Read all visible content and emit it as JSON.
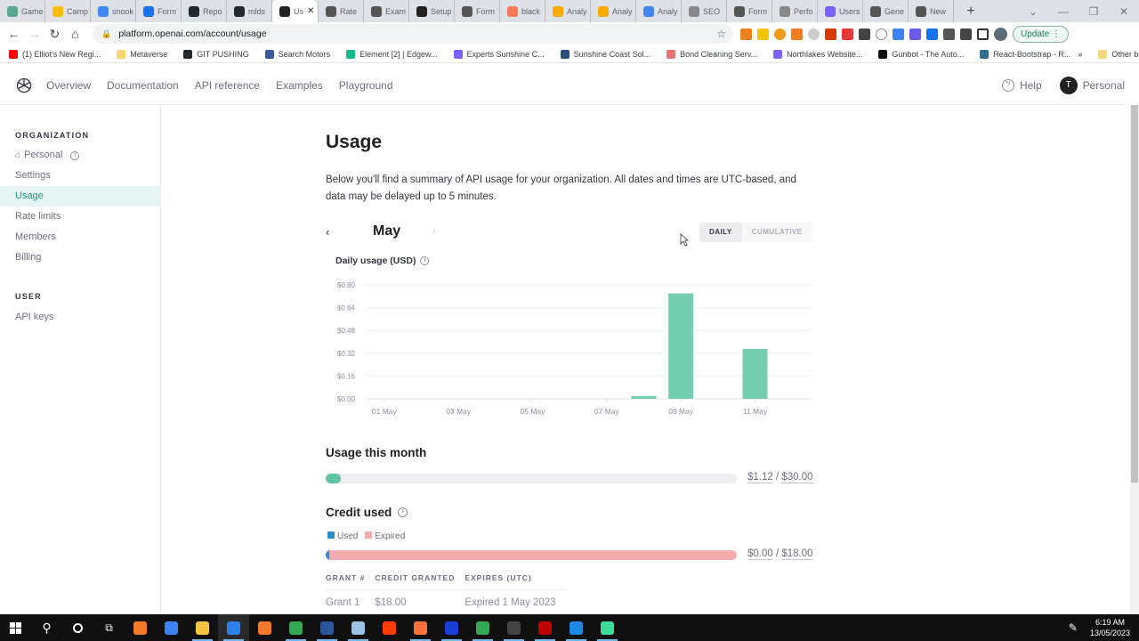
{
  "browser": {
    "tabs": [
      {
        "label": "Game",
        "color": "#5aa68f"
      },
      {
        "label": "Camp",
        "color": "#fbbc04"
      },
      {
        "label": "snook",
        "color": "#4285f4"
      },
      {
        "label": "Form",
        "color": "#1a73e8"
      },
      {
        "label": "Repo",
        "color": "#24292f"
      },
      {
        "label": "mlds",
        "color": "#24292f"
      },
      {
        "label": "Us",
        "color": "#202123",
        "active": true
      },
      {
        "label": "Rate",
        "color": "#555"
      },
      {
        "label": "Exam",
        "color": "#555"
      },
      {
        "label": "Setup",
        "color": "#222"
      },
      {
        "label": "Form",
        "color": "#555"
      },
      {
        "label": "black",
        "color": "#ff7a59"
      },
      {
        "label": "Analy",
        "color": "#f9ab00"
      },
      {
        "label": "Analy",
        "color": "#f9ab00"
      },
      {
        "label": "Analy",
        "color": "#4285f4"
      },
      {
        "label": "SEO",
        "color": "#888"
      },
      {
        "label": "Form",
        "color": "#555"
      },
      {
        "label": "Perfo",
        "color": "#888"
      },
      {
        "label": "Users",
        "color": "#7b61ff"
      },
      {
        "label": "Gene",
        "color": "#555"
      },
      {
        "label": "New",
        "color": "#555"
      }
    ],
    "new_tab_label": "+",
    "url": "platform.openai.com/account/usage",
    "update_label": "Update",
    "bookmarks": [
      {
        "label": "(1) Elliot's New Regi...",
        "color": "#ff0000"
      },
      {
        "label": "Metaverse",
        "color": "#f9d56e"
      },
      {
        "label": "GIT PUSHING",
        "color": "#24292f"
      },
      {
        "label": "Search Motors",
        "color": "#3b5998"
      },
      {
        "label": "Element [2] | Edgew...",
        "color": "#0dbd8b"
      },
      {
        "label": "Experts Sunshine C...",
        "color": "#7b61ff"
      },
      {
        "label": "Sunshine Coast Sol...",
        "color": "#2d4f7c"
      },
      {
        "label": "Bond Cleaning Serv...",
        "color": "#e57373"
      },
      {
        "label": "Northlakes Website...",
        "color": "#7b61ff"
      },
      {
        "label": "Gunbot - The Auto...",
        "color": "#111"
      },
      {
        "label": "React-Bootstrap - R...",
        "color": "#2f6f8f"
      }
    ],
    "more_bookmarks": "»",
    "other_bookmarks": "Other bookmarks"
  },
  "header": {
    "nav": [
      "Overview",
      "Documentation",
      "API reference",
      "Examples",
      "Playground"
    ],
    "help": "Help",
    "help_icon": "?",
    "avatar_initial": "T",
    "account": "Personal"
  },
  "sidebar": {
    "org_title": "ORGANIZATION",
    "org_name": "Personal",
    "org_items": [
      "Settings",
      "Usage",
      "Rate limits",
      "Members",
      "Billing"
    ],
    "active_item": "Usage",
    "user_title": "USER",
    "user_items": [
      "API keys"
    ]
  },
  "main": {
    "title": "Usage",
    "description": "Below you'll find a summary of API usage for your organization. All dates and times are UTC-based, and data may be delayed up to 5 minutes.",
    "month": "May",
    "prev_icon": "‹",
    "next_icon": "›",
    "toggle": {
      "daily": "DAILY",
      "cumulative": "CUMULATIVE",
      "selected": "DAILY"
    },
    "chart_title": "Daily usage (USD)",
    "usage_this_month": {
      "title": "Usage this month",
      "used": "$1.12",
      "limit": "$30.00",
      "fraction": 0.037,
      "color": "#5fc4a3"
    },
    "credit": {
      "title": "Credit used",
      "legend": [
        {
          "label": "Used",
          "color": "#2d8fc9"
        },
        {
          "label": "Expired",
          "color": "#f4adad"
        }
      ],
      "used": "$0.00",
      "total": "$18.00",
      "used_fraction": 0.0,
      "expired_fraction": 1.0,
      "table": {
        "headers": [
          "GRANT #",
          "CREDIT GRANTED",
          "EXPIRES (UTC)"
        ],
        "rows": [
          [
            "Grant 1",
            "$18.00",
            "Expired 1 May 2023"
          ]
        ]
      }
    }
  },
  "chart_data": {
    "type": "bar",
    "title": "Daily usage (USD)",
    "xlabel": "",
    "ylabel": "",
    "categories": [
      "01 May",
      "02 May",
      "03 May",
      "04 May",
      "05 May",
      "06 May",
      "07 May",
      "08 May",
      "09 May",
      "10 May",
      "11 May",
      "12 May"
    ],
    "values": [
      0,
      0,
      0,
      0,
      0,
      0,
      0,
      0.02,
      0.74,
      0,
      0.35,
      0
    ],
    "x_tick_labels": [
      "01 May",
      "03 May",
      "05 May",
      "07 May",
      "09 May",
      "11 May"
    ],
    "y_tick_labels": [
      "$0.00",
      "$0.16",
      "$0.32",
      "$0.48",
      "$0.64",
      "$0.80"
    ],
    "y_ticks": [
      0,
      0.16,
      0.32,
      0.48,
      0.64,
      0.8
    ],
    "ylim": [
      0,
      0.8
    ],
    "grid": true,
    "bar_color": "#74ceb0"
  },
  "taskbar": {
    "apps": [
      {
        "name": "blender",
        "color": "#f5792a",
        "running": false
      },
      {
        "name": "app-g",
        "color": "#3b82f6",
        "running": false
      },
      {
        "name": "file-explorer",
        "color": "#f6c342",
        "running": true
      },
      {
        "name": "vscode",
        "color": "#2f80ed",
        "running": true,
        "active": true
      },
      {
        "name": "blender-2",
        "color": "#f5792a",
        "running": false
      },
      {
        "name": "chrome",
        "color": "#34a853",
        "running": true
      },
      {
        "name": "word",
        "color": "#2b579a",
        "running": true
      },
      {
        "name": "app-notes",
        "color": "#9cc3e6",
        "running": true
      },
      {
        "name": "illustrator",
        "color": "#ff3d00",
        "running": false
      },
      {
        "name": "firefox",
        "color": "#ff7139",
        "running": true
      },
      {
        "name": "app-blue",
        "color": "#1a3fd6",
        "running": true
      },
      {
        "name": "chrome-2",
        "color": "#34a853",
        "running": true
      },
      {
        "name": "terminal",
        "color": "#444",
        "running": true
      },
      {
        "name": "filezilla",
        "color": "#bf0000",
        "running": true
      },
      {
        "name": "mail",
        "color": "#1e88e5",
        "running": true
      },
      {
        "name": "app-green",
        "color": "#3ddc97",
        "running": true
      }
    ],
    "time": "6:19 AM",
    "date": "13/05/2023"
  }
}
